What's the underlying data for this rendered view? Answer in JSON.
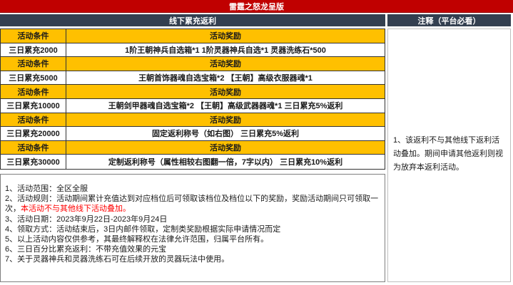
{
  "title": "雷霆之怒龙呈版",
  "colors": {
    "title_bg": "#c00000",
    "section_header_bg": "#333f50",
    "highlight_row_bg": "#ffc000",
    "warning_text": "#ff0000"
  },
  "left_table": {
    "header": "线下累充返利",
    "col_condition": "活动条件",
    "col_reward": "活动奖励",
    "rows": [
      {
        "condition": "三日累充2000",
        "reward": "1阶王朝神兵自选箱*1 1阶灵器神兵自选*1 灵器洗练石*500"
      },
      {
        "condition": "三日累充5000",
        "reward": "王朝首饰器魂自选宝箱*2 【王朝】高级衣服器魂*1"
      },
      {
        "condition": "三日累充10000",
        "reward": "王朝剑甲器魂自选宝箱*2 【王朝】高级武器器魂*1 三日累充5%返利"
      },
      {
        "condition": "三日累充20000",
        "reward": "固定返利称号（如右图） 三日累充5%返利"
      },
      {
        "condition": "三日累充30000",
        "reward": "定制返利称号（属性相较右图翻一倍，7字以内） 三日累充10%返利"
      }
    ]
  },
  "notes": [
    {
      "text": "1、活动范围：全区全服"
    },
    {
      "text": "2、活动规则：活动期间累计充值达到对应档位后可领取该档位及档位以下的奖励，奖励活动期间只可领取一次，",
      "red_text": "本活动不与其他线下活动叠加。"
    },
    {
      "text": "3、活动日期：2023年9月22日-2023年9月24日"
    },
    {
      "text": "4、领取方式：活动结束后，3日内邮件领取，定制类奖励根据实际申请情况而定"
    },
    {
      "text": "5、以上活动内容仅供参考，其最终解释权在法律允许范围，归属平台所有。"
    },
    {
      "text": "6、三日百分比累充返利：不带充值效果的元宝"
    },
    {
      "text": "7、关于灵器神兵和灵器洗练石可在后续开放的灵器玩法中使用。"
    }
  ],
  "right_panel": {
    "header": "注释（平台必看）",
    "note": "1、该返利不与其他线下返利活动叠加。期间申请其他返利则视为放弃本返利活动。"
  }
}
